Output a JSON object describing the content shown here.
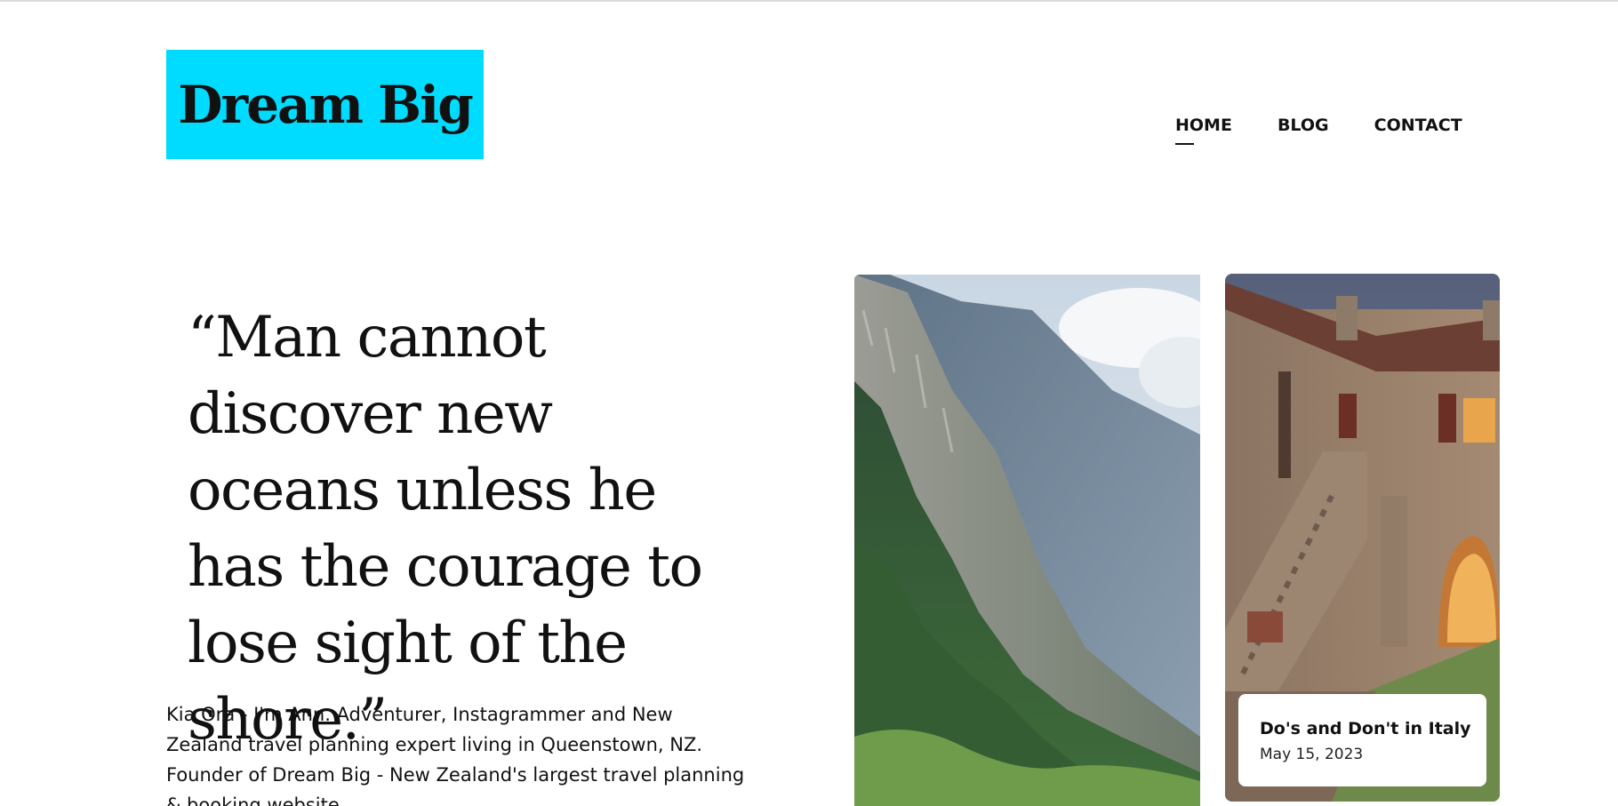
{
  "brand": {
    "logo_text": "Dream Big",
    "accent_color": "#00dcff"
  },
  "nav": {
    "items": [
      {
        "label": "HOME",
        "active": true
      },
      {
        "label": "BLOG",
        "active": false
      },
      {
        "label": "CONTACT",
        "active": false
      }
    ]
  },
  "hero": {
    "quote": "“Man cannot discover new oceans unless he has the courage to lose sight of the shore.”",
    "bio": "Kia Ora - I'm Ann. Adventurer, Instagrammer and New Zealand travel planning expert living in Queenstown, NZ. Founder of Dream Big - New Zealand's largest travel planning & booking website."
  },
  "featured_post": {
    "title": "Do's and Don't in Italy",
    "date": "May 15, 2023"
  }
}
